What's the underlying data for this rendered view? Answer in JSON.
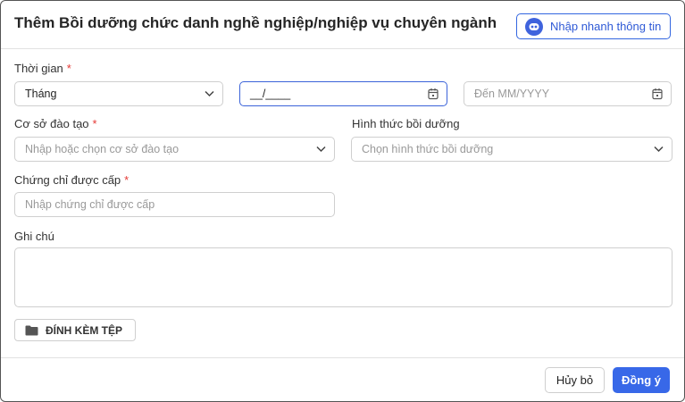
{
  "dialog": {
    "title": "Thêm Bồi dưỡng chức danh nghề nghiệp/nghiệp vụ chuyên ngành",
    "quick_fill_label": "Nhập nhanh thông tin"
  },
  "form": {
    "time": {
      "label": "Thời gian",
      "required_mark": "*",
      "unit_value": "Tháng",
      "from_value": "__/____",
      "to_placeholder": "Đến MM/YYYY"
    },
    "institution": {
      "label": "Cơ sở đào tạo",
      "required_mark": "*",
      "placeholder": "Nhập hoặc chọn cơ sở đào tạo"
    },
    "training_form": {
      "label": "Hình thức bồi dưỡng",
      "placeholder": "Chọn hình thức bồi dưỡng"
    },
    "certificate": {
      "label": "Chứng chỉ được cấp",
      "required_mark": "*",
      "placeholder": "Nhập chứng chỉ được cấp"
    },
    "notes": {
      "label": "Ghi chú",
      "value": ""
    },
    "attach_label": "ĐÍNH KÈM TỆP"
  },
  "footer": {
    "cancel_label": "Hủy bỏ",
    "ok_label": "Đồng ý"
  },
  "icons": {
    "quick_fill": "robot-icon",
    "dropdown": "chevron-down-icon",
    "date": "calendar-icon",
    "attach": "folder-icon"
  },
  "colors": {
    "primary": "#3868e8",
    "required": "#e53935"
  }
}
